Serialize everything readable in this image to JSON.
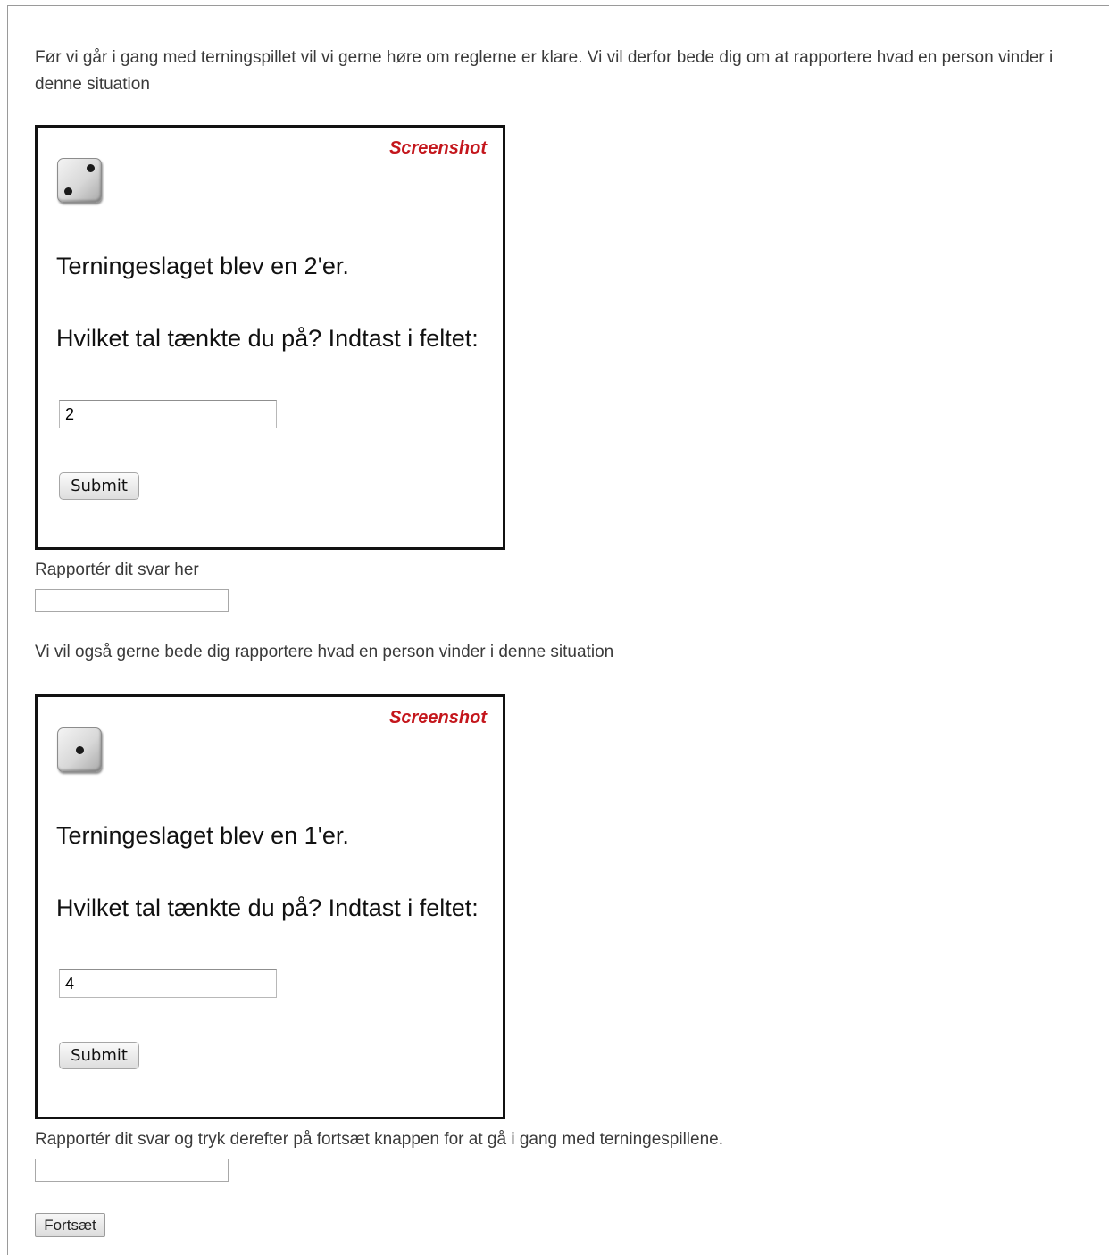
{
  "intro_text": "Før vi går i gang med terningspillet vil vi gerne høre om reglerne er klare. Vi vil derfor bede dig om at rapportere hvad en person vinder i denne situation",
  "screenshots": [
    {
      "label": "Screenshot",
      "die_icon": "die-face-two-icon",
      "roll_text": "Terningeslaget blev en 2'er.",
      "question_text": "Hvilket tal tænkte du på? Indtast i feltet:",
      "input_value": "2",
      "submit_label": "Submit"
    },
    {
      "label": "Screenshot",
      "die_icon": "die-face-one-icon",
      "roll_text": "Terningeslaget blev en 1'er.",
      "question_text": "Hvilket tal tænkte du på? Indtast i feltet:",
      "input_value": "4",
      "submit_label": "Submit"
    }
  ],
  "report_label_1": "Rapportér dit svar her",
  "report_input_1_value": "",
  "second_prompt": "Vi vil også gerne bede dig rapportere hvad en person vinder i denne situation",
  "report_label_2": "Rapportér dit svar og tryk derefter på fortsæt knappen for at gå i gang med terningespillene.",
  "report_input_2_value": "",
  "continue_label": "Fortsæt",
  "colors": {
    "screenshot_label": "#c4161c",
    "frame_border": "#111111",
    "body_text": "#3a3a3a"
  }
}
